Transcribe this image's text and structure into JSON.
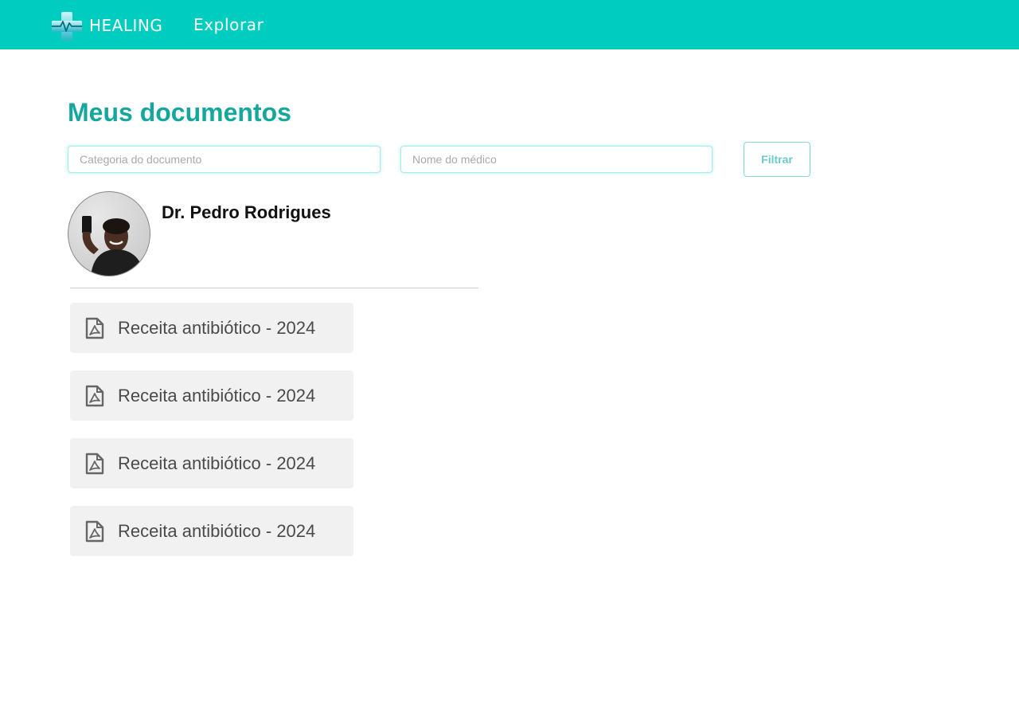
{
  "header": {
    "brand": "HEALING",
    "nav_explore": "Explorar",
    "background_color": "#00cdbf"
  },
  "page": {
    "title": "Meus documentos",
    "title_color": "#15a79d"
  },
  "filters": {
    "category_placeholder": "Categoria do documento",
    "doctor_placeholder": "Nome do médico",
    "filter_button": "Filtrar"
  },
  "doctor": {
    "name": "Dr. Pedro Rodrigues"
  },
  "documents": [
    {
      "label": "Receita antibiótico - 2024",
      "icon": "pdf-file-icon"
    },
    {
      "label": "Receita antibiótico - 2024",
      "icon": "pdf-file-icon"
    },
    {
      "label": "Receita antibiótico - 2024",
      "icon": "pdf-file-icon"
    },
    {
      "label": "Receita antibiótico - 2024",
      "icon": "pdf-file-icon"
    }
  ]
}
